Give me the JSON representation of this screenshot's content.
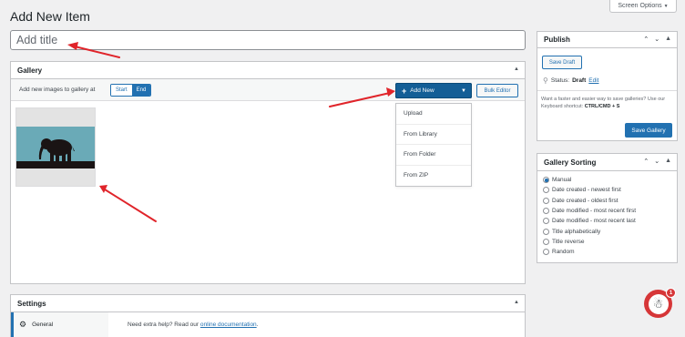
{
  "header": {
    "screen_options": "Screen Options",
    "page_title": "Add New Item"
  },
  "title_field": {
    "placeholder": "Add title",
    "value": ""
  },
  "gallery": {
    "heading": "Gallery",
    "add_images_label": "Add new images to gallery at",
    "position_start": "Start",
    "position_end": "End",
    "position_selected": "End",
    "add_new_button": "Add New",
    "bulk_editor_button": "Bulk Editor",
    "add_new_menu": [
      "Upload",
      "From Library",
      "From Folder",
      "From ZIP"
    ]
  },
  "settings": {
    "heading": "Settings",
    "nav_general": "General",
    "help_text": "Need extra help? Read our",
    "help_link": "online documentation",
    "help_end": "."
  },
  "publish": {
    "heading": "Publish",
    "save_draft": "Save Draft",
    "status_label": "Status:",
    "status_value": "Draft",
    "status_edit": "Edit",
    "hint_text": "Want a faster and easier way to save galleries? Use our Keyboard shortcut:",
    "hint_shortcut": "CTRL/CMD + S",
    "save_gallery": "Save Gallery"
  },
  "sorting": {
    "heading": "Gallery Sorting",
    "options": [
      "Manual",
      "Date created - newest first",
      "Date created - oldest first",
      "Date modified - most recent first",
      "Date modified - most recent last",
      "Title alphabetically",
      "Title reverse",
      "Random"
    ],
    "selected": "Manual"
  },
  "notification": {
    "count": "1"
  },
  "colors": {
    "accent": "#2271b1",
    "accent_dark": "#135e96",
    "annotation_arrow": "#e0242a"
  }
}
